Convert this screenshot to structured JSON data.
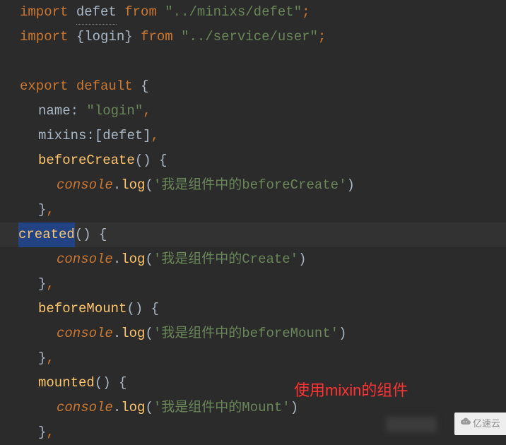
{
  "code": {
    "l1": {
      "kw1": "import",
      "id": "defet",
      "kw2": "from",
      "str": "\"../minixs/defet\"",
      "semi": ";"
    },
    "l2": {
      "kw1": "import",
      "brace_o": "{",
      "id": "login",
      "brace_c": "}",
      "kw2": "from",
      "str": "\"../service/user\"",
      "semi": ";"
    },
    "l3": "",
    "l4": {
      "kw1": "export",
      "kw2": "default",
      "brace": "{"
    },
    "l5": {
      "key": "name",
      "colon": ":",
      "str": "\"login\"",
      "comma": ","
    },
    "l6": {
      "key": "mixins",
      "colon": ":",
      "bracket_o": "[",
      "id": "defet",
      "bracket_c": "]",
      "comma": ","
    },
    "l7": {
      "fn": "beforeCreate",
      "parens": "()",
      "brace": "{"
    },
    "l8": {
      "obj": "console",
      "dot": ".",
      "method": "log",
      "paren_o": "(",
      "str": "'我是组件中的beforeCreate'",
      "paren_c": ")"
    },
    "l9": {
      "brace": "}",
      "comma": ","
    },
    "l10": {
      "fn": "created",
      "parens": "()",
      "brace": "{"
    },
    "l11": {
      "obj": "console",
      "dot": ".",
      "method": "log",
      "paren_o": "(",
      "str": "'我是组件中的Create'",
      "paren_c": ")"
    },
    "l12": {
      "brace": "}",
      "comma": ","
    },
    "l13": {
      "fn": "beforeMount",
      "parens": "()",
      "brace": "{"
    },
    "l14": {
      "obj": "console",
      "dot": ".",
      "method": "log",
      "paren_o": "(",
      "str": "'我是组件中的beforeMount'",
      "paren_c": ")"
    },
    "l15": {
      "brace": "}",
      "comma": ","
    },
    "l16": {
      "fn": "mounted",
      "parens": "()",
      "brace": "{"
    },
    "l17": {
      "obj": "console",
      "dot": ".",
      "method": "log",
      "paren_o": "(",
      "str": "'我是组件中的Mount'",
      "paren_c": ")"
    },
    "l18": {
      "brace": "}",
      "comma": ","
    }
  },
  "annotation": "使用mixin的组件",
  "watermark": "亿速云"
}
